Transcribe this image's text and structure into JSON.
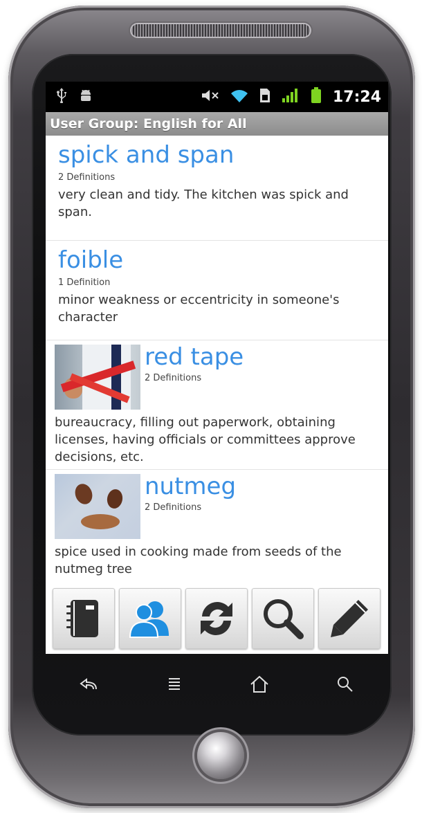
{
  "status_bar": {
    "time": "17:24",
    "left_icons": [
      "usb-icon",
      "android-debug-icon"
    ],
    "right_icons": [
      "mute-icon",
      "wifi-icon",
      "sim-icon",
      "signal-icon",
      "battery-icon"
    ]
  },
  "title_bar": {
    "title": "User Group: English for All"
  },
  "entries": [
    {
      "word": "spick and span",
      "definitions": "2 Definitions",
      "description": "very clean and tidy. The kitchen was spick and span."
    },
    {
      "word": "foible",
      "definitions": "1 Definition",
      "description": "minor weakness or eccentricity in someone's character"
    },
    {
      "word": "red tape",
      "definitions": "2 Definitions",
      "description": "bureaucracy, filling out paperwork, obtaining licenses, having officials or committees approve decisions, etc."
    },
    {
      "word": "nutmeg",
      "definitions": "2 Definitions",
      "description": "spice used in cooking made from seeds of the nutmeg tree"
    }
  ],
  "toolbar": {
    "buttons": [
      "notebook-icon",
      "user-group-icon",
      "refresh-icon",
      "search-icon",
      "edit-pencil-icon"
    ]
  },
  "nav_bar": {
    "buttons": [
      "back-icon",
      "menu-icon",
      "home-icon",
      "search-icon"
    ]
  },
  "colors": {
    "word": "#3a8fe3",
    "title_bar": "#9a9a9a",
    "user_group_icon": "#1f8fe0"
  }
}
